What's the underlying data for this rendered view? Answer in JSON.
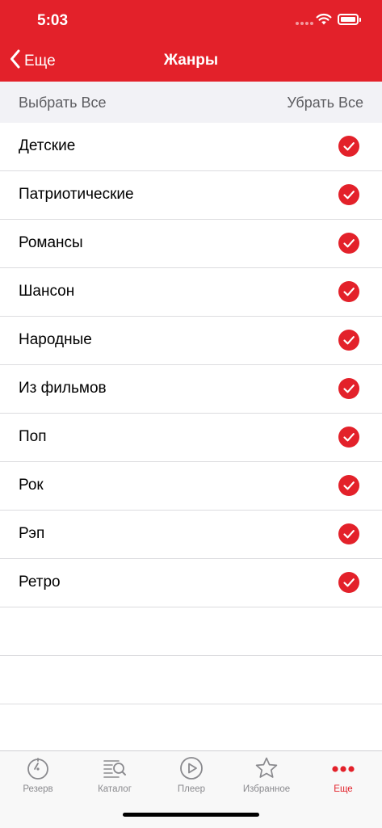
{
  "status": {
    "time": "5:03"
  },
  "nav": {
    "back_label": "Еще",
    "title": "Жанры"
  },
  "actions": {
    "select_all": "Выбрать Все",
    "deselect_all": "Убрать Все"
  },
  "genres": [
    {
      "label": "Детские",
      "checked": true
    },
    {
      "label": "Патриотические",
      "checked": true
    },
    {
      "label": "Романсы",
      "checked": true
    },
    {
      "label": "Шансон",
      "checked": true
    },
    {
      "label": "Народные",
      "checked": true
    },
    {
      "label": "Из фильмов",
      "checked": true
    },
    {
      "label": "Поп",
      "checked": true
    },
    {
      "label": "Рок",
      "checked": true
    },
    {
      "label": "Рэп",
      "checked": true
    },
    {
      "label": "Ретро",
      "checked": true
    }
  ],
  "tabbar": {
    "tabs": [
      {
        "label": "Резерв",
        "icon": "timer-icon",
        "active": false
      },
      {
        "label": "Каталог",
        "icon": "catalog-search-icon",
        "active": false
      },
      {
        "label": "Плеер",
        "icon": "play-icon",
        "active": false
      },
      {
        "label": "Избранное",
        "icon": "star-icon",
        "active": false
      },
      {
        "label": "Еще",
        "icon": "more-icon",
        "active": true
      }
    ]
  },
  "colors": {
    "accent": "#e3212a",
    "inactive": "#8a8a8e",
    "separator": "#dcdcdf",
    "action_bar": "#f2f2f6"
  }
}
